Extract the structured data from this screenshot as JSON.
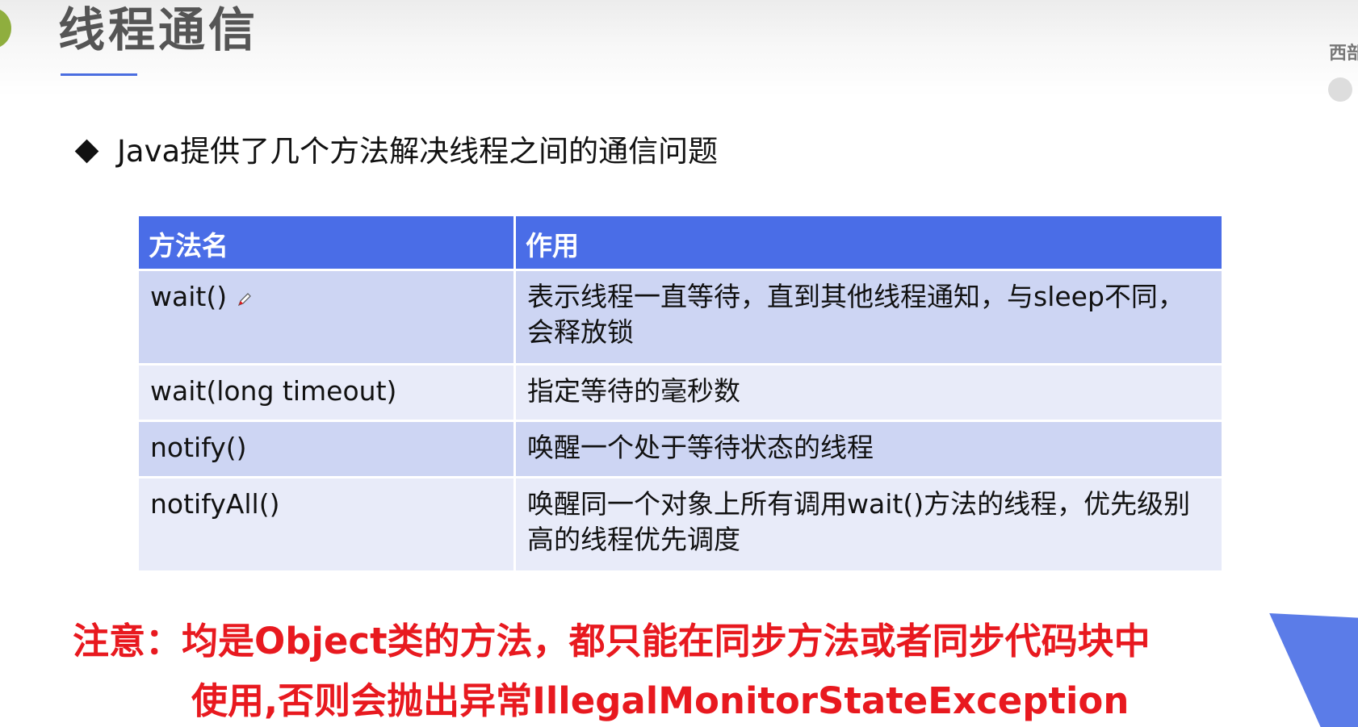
{
  "slide": {
    "title": "线程通信",
    "right_edge_text": "西部",
    "bullet": "Java提供了几个方法解决线程之间的通信问题"
  },
  "table": {
    "headers": [
      "方法名",
      "作用"
    ],
    "rows": [
      {
        "name": "wait()",
        "desc": "表示线程一直等待，直到其他线程通知，与sleep不同，会释放锁"
      },
      {
        "name": "wait(long timeout)",
        "desc": "指定等待的毫秒数"
      },
      {
        "name": "notify()",
        "desc": "唤醒一个处于等待状态的线程"
      },
      {
        "name": "notifyAll()",
        "desc": "唤醒同一个对象上所有调用wait()方法的线程，优先级别高的线程优先调度"
      }
    ]
  },
  "note": {
    "line1": "注意：均是Object类的方法，都只能在同步方法或者同步代码块中",
    "line2": "使用,否则会抛出异常IllegalMonitorStateException"
  },
  "colors": {
    "title": "#555555",
    "accent_blue": "#4a6de7",
    "row_dark": "#cdd5f3",
    "row_light": "#e8ebf9",
    "note_red": "#e8191f",
    "corner_badge": "#8fae3e"
  },
  "icons": {
    "pen": "pen-icon",
    "bullet": "diamond-bullet-icon"
  }
}
